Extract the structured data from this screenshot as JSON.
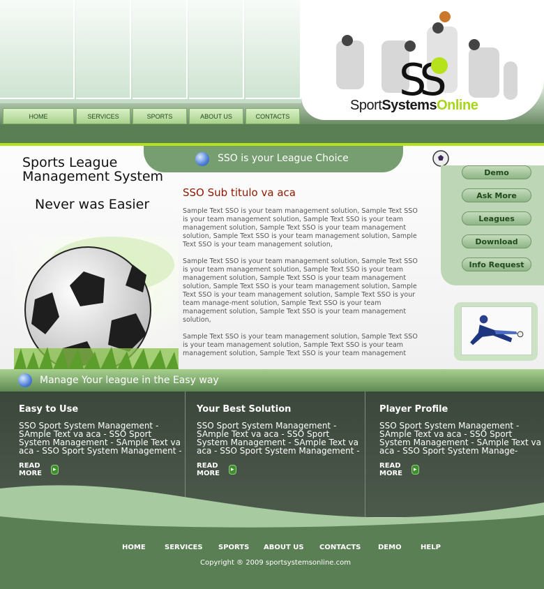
{
  "colors": {
    "brand_green": "#5b7f54",
    "lime": "#b6e21b",
    "light_green": "#bdd6b6",
    "heading_red": "#8b1a00",
    "dark_band": "#3b473b"
  },
  "header": {
    "nav": [
      {
        "label": "HOME"
      },
      {
        "label": "SERVICES"
      },
      {
        "label": "SPORTS"
      },
      {
        "label": "ABOUT US"
      },
      {
        "label": "CONTACTS"
      }
    ],
    "brand": {
      "part1": "Sport",
      "part2": "Systems",
      "part3": "Online"
    }
  },
  "main": {
    "left_title_line1": "Sports League",
    "left_title_line2": "Management System",
    "left_subtitle": "Never was Easier",
    "tab_text": "SSO is your League Choice",
    "subheading": "SSO Sub titulo va aca",
    "paragraphs": [
      "Sample Text SSO is your team management solution, Sample Text SSO is your team management solution, Sample Text SSO is your team management solution, Sample Text SSO is your team management solution, Sample Text SSO is your team management solution, Sample Text SSO is your team management solution,",
      "Sample Text SSO is your team management solution, Sample Text SSO is your team management solution, Sample Text SSO is your team management solution, Sample Text SSO is your team management solution, Sample Text SSO is your team management solution, Sample Text SSO is your team management solution, Sample Text SSO is your team manage-ment solution, Sample Text SSO is your team management solution, Sample Text SSO is your team management solution,",
      "Sample Text SSO is your team management solution, Sample Text SSO is your team management solution, Sample Text SSO is your team management solution, Sample Text SSO is your team management"
    ],
    "side_buttons": [
      {
        "label": "Demo"
      },
      {
        "label": "Ask More"
      },
      {
        "label": "Leagues"
      },
      {
        "label": "Download"
      },
      {
        "label": "Info Request"
      }
    ]
  },
  "bar": {
    "text": "Manage Your league in the Easy way"
  },
  "features": [
    {
      "title": "Easy to Use",
      "body": "SSO Sport System Management - SAmple Text va aca - SSO Sport System Management - SAmple Text va aca - SSO Sport System Management -",
      "more": "READ MORE"
    },
    {
      "title": "Your Best Solution",
      "body": "SSO Sport System Management - SAmple Text va aca - SSO Sport System Management - SAmple Text va aca - SSO Sport System Management -",
      "more": "READ MORE"
    },
    {
      "title": "Player Profile",
      "body": "SSO Sport System Management - SAmple Text va aca - SSO Sport System Management - SAmple Text va aca - SSO Sport System Manage-",
      "more": "READ MORE"
    }
  ],
  "footer": {
    "links": [
      {
        "label": "HOME"
      },
      {
        "label": "SERVICES"
      },
      {
        "label": "SPORTS"
      },
      {
        "label": "ABOUT US"
      },
      {
        "label": "CONTACTS"
      },
      {
        "label": "DEMO"
      },
      {
        "label": "HELP"
      }
    ],
    "copyright": "Copyright ® 2009 sportsystemsonline.com"
  }
}
